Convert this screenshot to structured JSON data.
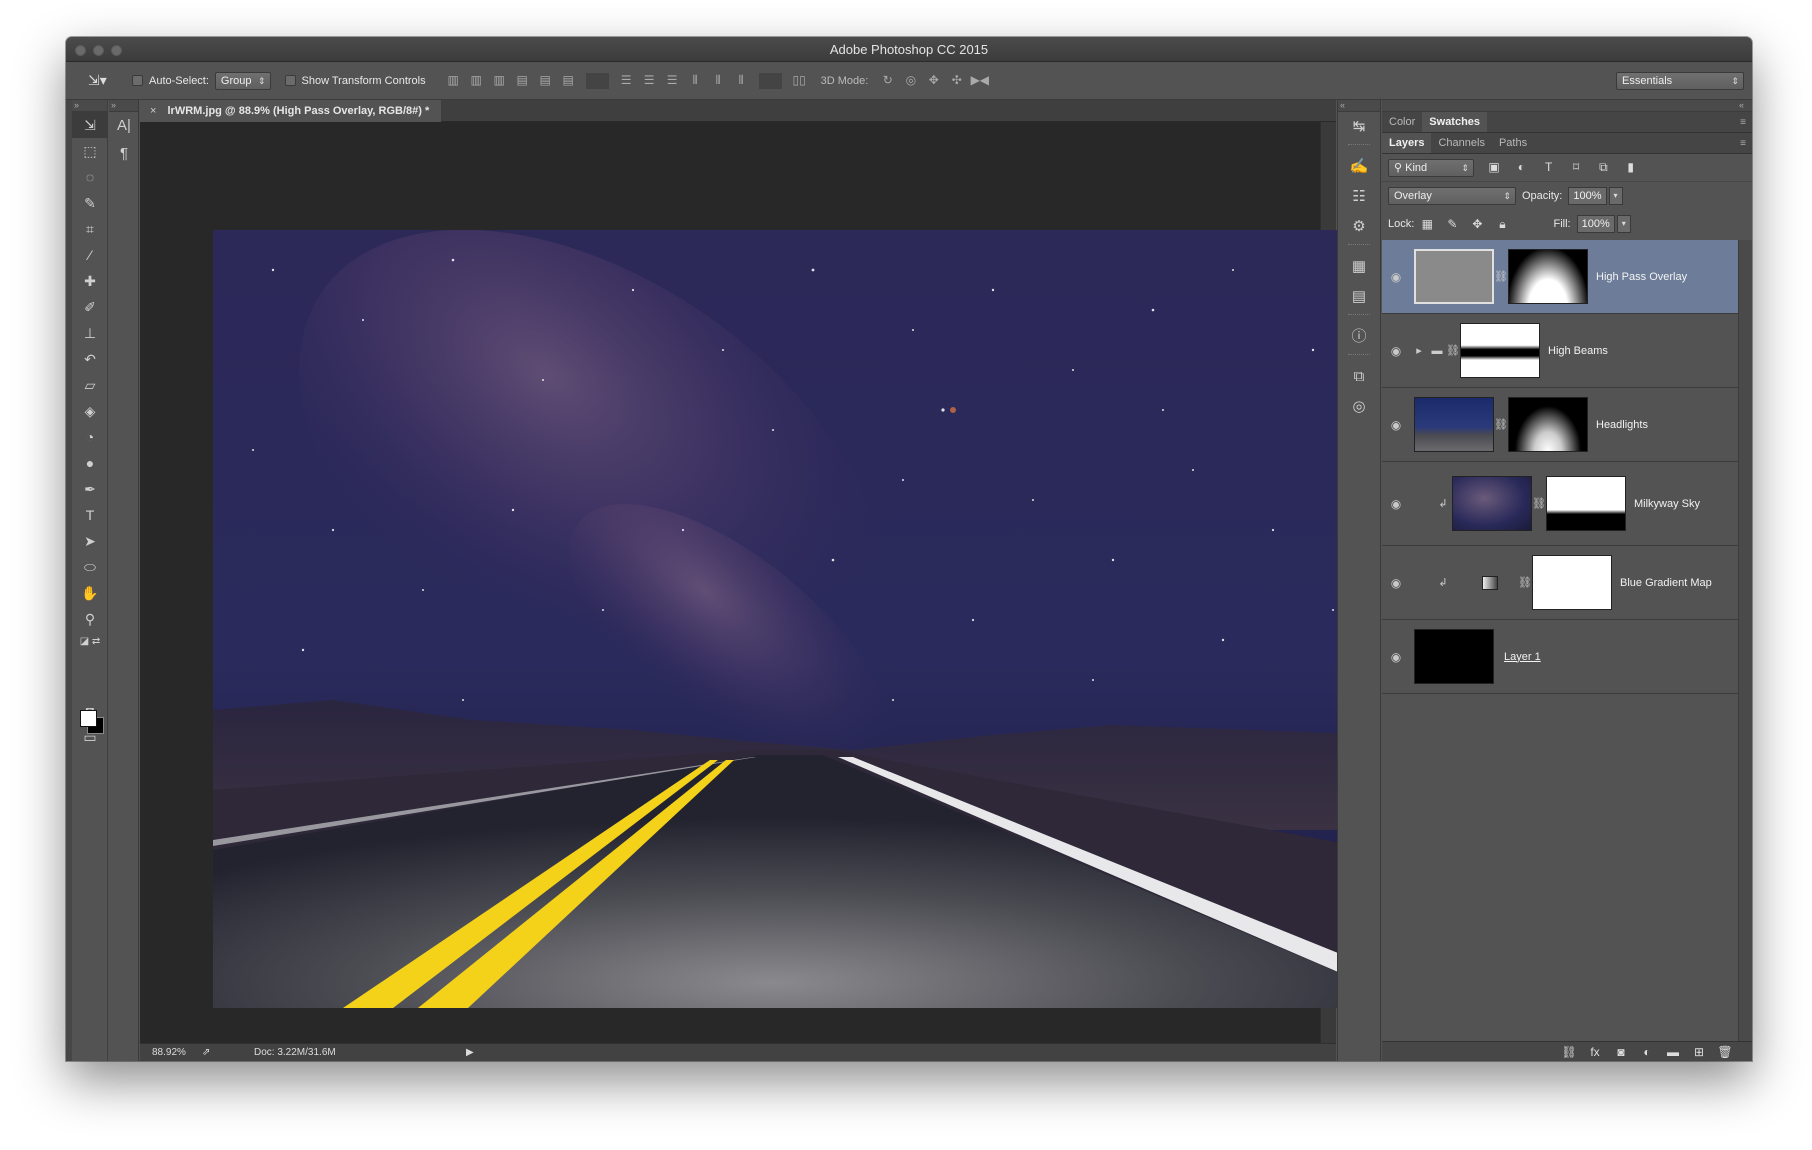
{
  "app": {
    "title": "Adobe Photoshop CC 2015"
  },
  "options_bar": {
    "auto_select_label": "Auto-Select:",
    "auto_select_value": "Group",
    "transform_controls_label": "Show Transform Controls",
    "mode_3d_label": "3D Mode:",
    "workspace_value": "Essentials"
  },
  "document": {
    "tab_title": "lrWRM.jpg @ 88.9% (High Pass Overlay, RGB/8#) *",
    "zoom": "88.92%",
    "doc_size": "Doc: 3.22M/31.6M"
  },
  "panels": {
    "top_tabs": [
      {
        "label": "Color",
        "active": false
      },
      {
        "label": "Swatches",
        "active": true
      }
    ],
    "layer_tabs": [
      {
        "label": "Layers",
        "active": true
      },
      {
        "label": "Channels",
        "active": false
      },
      {
        "label": "Paths",
        "active": false
      }
    ],
    "filter_kind": "Kind",
    "blend_mode": "Overlay",
    "opacity_label": "Opacity:",
    "opacity_value": "100%",
    "lock_label": "Lock:",
    "fill_label": "Fill:",
    "fill_value": "100%"
  },
  "layers": [
    {
      "name": "High Pass Overlay",
      "selected": true
    },
    {
      "name": "High Beams",
      "selected": false
    },
    {
      "name": "Headlights",
      "selected": false
    },
    {
      "name": "Milkyway Sky",
      "selected": false
    },
    {
      "name": "Blue Gradient Map",
      "selected": false
    },
    {
      "name": "Layer 1",
      "selected": false
    }
  ],
  "colors": {
    "ui_background": "#535353",
    "selected_layer": "#6d7d99",
    "canvas_background": "#282828",
    "road_line_yellow": "#f5d21a"
  }
}
